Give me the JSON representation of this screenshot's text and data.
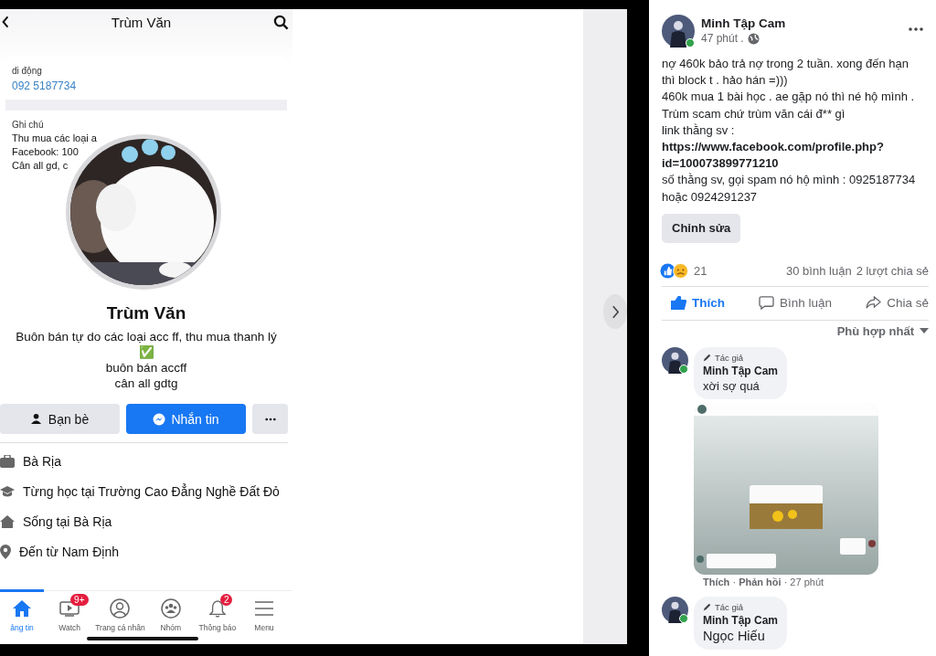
{
  "phone": {
    "header_title": "Trùm Văn",
    "contact": {
      "label": "di động",
      "value": "092 5187734"
    },
    "notes": {
      "label": "Ghi chú",
      "lines": [
        "Thu mua các loại a",
        "Facebook: 100",
        "Cân all gd, c"
      ]
    },
    "profile": {
      "name": "Trùm Văn",
      "bio_lines": [
        "Buôn bán tự do các loại acc ff, thu mua thanh lý",
        "✅",
        "buôn bán accff",
        "cân all gdtg"
      ]
    },
    "buttons": [
      {
        "label": "Bạn bè",
        "kind": "friends"
      },
      {
        "label": "Nhắn tin",
        "kind": "message"
      },
      {
        "kind": "more"
      }
    ],
    "info": [
      {
        "text": "Bà Rịa",
        "kind": "work"
      },
      {
        "text": "Từng học tại Trường Cao Đẳng Nghề Đất Đỏ",
        "kind": "school"
      },
      {
        "text": "Sống tại Bà Rịa",
        "kind": "home"
      },
      {
        "text": "Đến từ Nam Định",
        "kind": "place"
      }
    ],
    "nav": [
      {
        "label": "ảng tin",
        "kind": "home",
        "selected": true
      },
      {
        "label": "Watch",
        "kind": "watch",
        "badge": "9+",
        "selected": false
      },
      {
        "label": "Trang cá nhân",
        "kind": "profile",
        "selected": false
      },
      {
        "label": "Nhóm",
        "kind": "groups",
        "selected": false
      },
      {
        "label": "Thông báo",
        "kind": "bell",
        "badge": "2",
        "selected": false
      },
      {
        "label": "Menu",
        "kind": "menu",
        "selected": false
      }
    ]
  },
  "post": {
    "author": "Minh Tập Cam",
    "time": "47 phút .",
    "lines": [
      {
        "text": "nợ 460k bảo trả nợ trong 2 tuần. xong đến hạn",
        "kind": "text"
      },
      {
        "text": "thì block t . hảo hán =)))",
        "kind": "text"
      },
      {
        "text": "460k mua 1 bài học . ae gặp nó thì né hộ mình .",
        "kind": "text"
      },
      {
        "text": "Trùm scam chứ trùm văn cái đ** gì",
        "kind": "text"
      },
      {
        "text": "link thằng sv :",
        "kind": "text"
      },
      {
        "text": "https://www.facebook.com/profile.php?",
        "kind": "link"
      },
      {
        "text": "id=100073899771210",
        "kind": "link"
      },
      {
        "text": "số thằng sv, gọi spam nó hộ mình : 0925187734",
        "kind": "text"
      },
      {
        "text": "hoặc 0924291237",
        "kind": "text"
      }
    ],
    "edit_button": "Chỉnh sửa",
    "reaction_count": "21",
    "comment_count": "30 bình luận",
    "share_count": "2 lượt chia sẻ",
    "actions": [
      {
        "label": "Thích",
        "kind": "like",
        "selected": true
      },
      {
        "label": "Bình luận",
        "kind": "comment",
        "selected": false
      },
      {
        "label": "Chia sẻ",
        "kind": "share",
        "selected": false
      }
    ],
    "sort": "Phù hợp nhất",
    "comments": [
      {
        "badge": "Tác giả",
        "author": "Minh Tập Cam",
        "text": "xời sợ quá",
        "meta": "**Thích** · **Phản hồi** · 27 phút"
      },
      {
        "badge": "Tác giả",
        "author": "Minh Tập Cam",
        "text": "Ngọc Hiếu"
      }
    ]
  }
}
